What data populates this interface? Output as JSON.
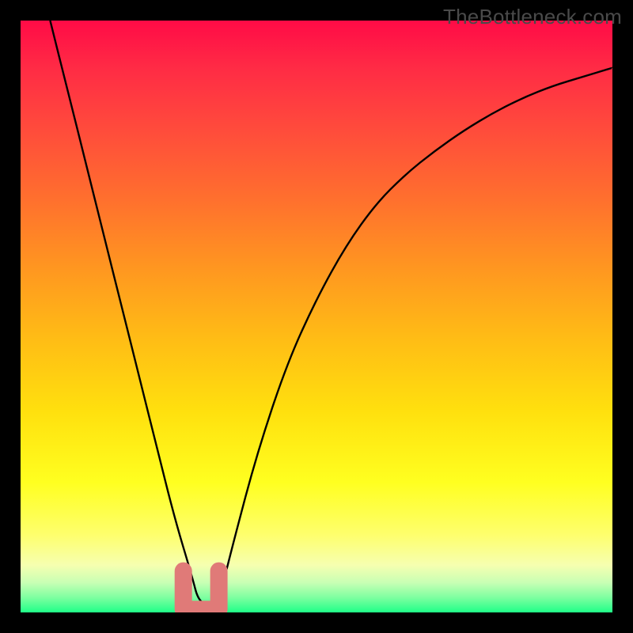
{
  "watermark": "TheBottleneck.com",
  "colors": {
    "frame": "#000000",
    "watermark_text": "#4a4a4a",
    "curve": "#000000",
    "marker": "#e07a78"
  },
  "chart_data": {
    "type": "line",
    "title": "",
    "xlabel": "",
    "ylabel": "",
    "xlim": [
      0,
      100
    ],
    "ylim": [
      0,
      100
    ],
    "grid": false,
    "legend": false,
    "annotations": [],
    "series": [
      {
        "name": "bottleneck-curve",
        "x": [
          5,
          8,
          11,
          14,
          17,
          20,
          23,
          26,
          29,
          30,
          32,
          34,
          36,
          40,
          45,
          50,
          55,
          60,
          65,
          70,
          75,
          80,
          85,
          90,
          95,
          100
        ],
        "y": [
          100,
          88,
          76,
          64,
          52,
          40,
          28,
          16,
          6,
          2,
          1,
          4,
          12,
          27,
          42,
          53,
          62,
          69,
          74,
          78,
          81.5,
          84.5,
          87,
          89,
          90.5,
          92
        ]
      }
    ],
    "markers": [
      {
        "name": "optimal-range-marker",
        "x_range": [
          27.5,
          33.5
        ],
        "y_range": [
          0.5,
          7
        ]
      }
    ],
    "background_gradient": {
      "top": "#ff0b46",
      "mid": "#ffe00e",
      "bottom": "#20ff88"
    }
  }
}
